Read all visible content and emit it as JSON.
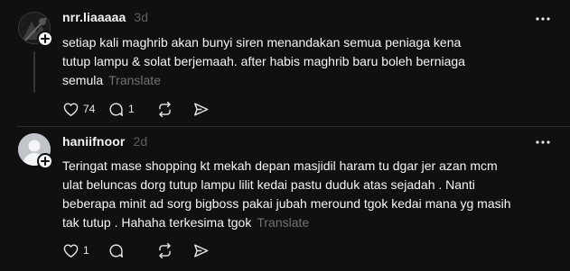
{
  "posts": [
    {
      "username": "nrr.liaaaaa",
      "time": "3d",
      "lines": [
        "setiap kali maghrib akan bunyi siren menandakan semua peniaga kena",
        "tutup lampu & solat berjemaah. after habis maghrib baru boleh berniaga",
        "semula"
      ],
      "translate_label": "Translate",
      "like_count": "74",
      "reply_count": "1"
    },
    {
      "username": "haniifnoor",
      "time": "2d",
      "lines": [
        "Teringat mase shopping kt mekah depan masjidil haram tu dgar jer azan mcm",
        "ulat beluncas dorg tutup lampu lilit kedai pastu duduk atas sejadah . Nanti",
        "beberapa minit ad sorg bigboss pakai jubah meround tgok kedai mana yg masih",
        "tak tutup . Hahaha terkesima tgok"
      ],
      "translate_label": "Translate",
      "like_count": "1"
    }
  ],
  "icons": {
    "more": "more-horizontal-icon",
    "like": "heart-icon",
    "reply": "comment-icon",
    "repost": "repost-icon",
    "share": "send-icon",
    "follow": "plus-icon"
  },
  "colors": {
    "background": "#101010",
    "text": "#f3f5f7",
    "secondary": "#6f7174",
    "divider": "#2d2d2d"
  }
}
